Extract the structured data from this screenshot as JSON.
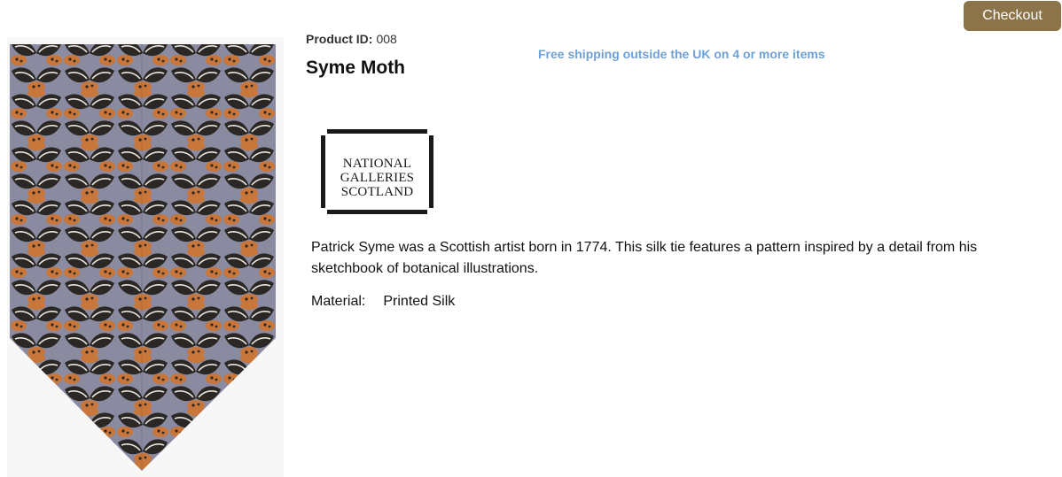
{
  "header": {
    "checkout_label": "Checkout"
  },
  "product": {
    "id_label": "Product ID:",
    "id_value": "008",
    "title": "Syme Moth",
    "shipping_notice": "Free shipping outside the UK on 4 or more items",
    "description": "Patrick Syme was a Scottish artist born in 1774.  This silk tie features a pattern inspired by a detail from his sketchbook of botanical illustrations.",
    "material_label": "Material:",
    "material_value": "Printed Silk"
  },
  "brand": {
    "lines": [
      "NATIONAL",
      "GALLERIES",
      "SCOTLAND"
    ]
  },
  "image": {
    "subject": "silk tie with orange moth and botanical leaf pattern on grey"
  },
  "colors": {
    "checkout_button": "#8b734a",
    "shipping_notice": "#6fa0d6",
    "tie_base": "#8a8aa0",
    "moth_orange": "#c8763a",
    "leaf_dark": "#2a2725"
  },
  "icons": {
    "product_image": "tie-image",
    "brand_logo": "national-galleries-scotland-logo"
  }
}
